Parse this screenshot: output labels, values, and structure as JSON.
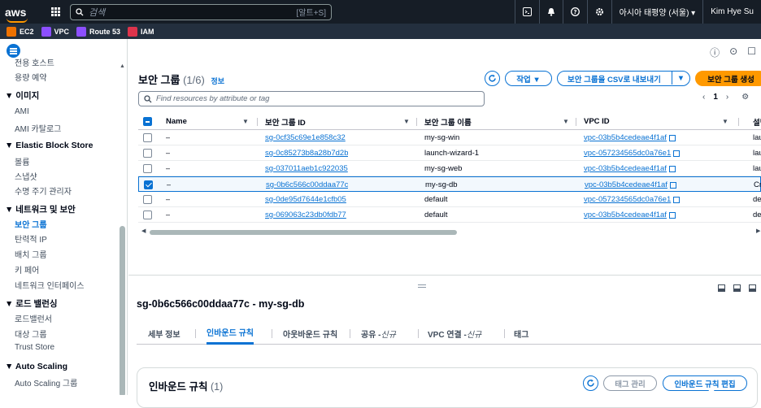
{
  "topbar": {
    "logo": "aws",
    "search_placeholder": "검색",
    "search_shortcut": "[알트+S]",
    "region": "아시아 태평양 (서울) ▾",
    "user": "Kim Hye Su"
  },
  "favorites": [
    {
      "label": "EC2",
      "color": "#ed7100"
    },
    {
      "label": "VPC",
      "color": "#8c4fff"
    },
    {
      "label": "Route 53",
      "color": "#8c4fff"
    },
    {
      "label": "IAM",
      "color": "#dd344c"
    }
  ],
  "sidebar": {
    "items": [
      {
        "label": "전용 호스트",
        "type": "item"
      },
      {
        "label": "용량 예약",
        "type": "item"
      },
      {
        "label": "▼ 이미지",
        "type": "header"
      },
      {
        "label": "AMI",
        "type": "item"
      },
      {
        "label": "AMI 카탈로그",
        "type": "item"
      },
      {
        "label": "▼ Elastic Block Store",
        "type": "header"
      },
      {
        "label": "볼륨",
        "type": "item"
      },
      {
        "label": "스냅샷",
        "type": "item"
      },
      {
        "label": "수명 주기 관리자",
        "type": "item"
      },
      {
        "label": "▼ 네트워크 및 보안",
        "type": "header"
      },
      {
        "label": "보안 그룹",
        "type": "active"
      },
      {
        "label": "탄력적 IP",
        "type": "item"
      },
      {
        "label": "배치 그룹",
        "type": "item"
      },
      {
        "label": "키 페어",
        "type": "item"
      },
      {
        "label": "네트워크 인터페이스",
        "type": "item"
      },
      {
        "label": "▼ 로드 밸런싱",
        "type": "header"
      },
      {
        "label": "로드밸런서",
        "type": "item"
      },
      {
        "label": "대상 그룹",
        "type": "item"
      },
      {
        "label": "Trust Store",
        "type": "item"
      },
      {
        "label": "▼ Auto Scaling",
        "type": "header"
      },
      {
        "label": "Auto Scaling 그룹",
        "type": "item"
      }
    ]
  },
  "panel": {
    "title": "보안 그룹",
    "count": "(1/6)",
    "info": "정보",
    "actions_label": "작업 ▼",
    "export_label": "보안 그룹을 CSV로 내보내기",
    "create_label": "보안 그룹 생성",
    "filter_placeholder": "Find resources by attribute or tag",
    "page": "1"
  },
  "table": {
    "headers": [
      "Name",
      "보안 그룹 ID",
      "보안 그룹 이름",
      "VPC ID",
      "설명"
    ],
    "rows": [
      {
        "name": "–",
        "id": "sg-0cf35c69e1e858c32",
        "group": "my-sg-win",
        "vpc": "vpc-03b5b4cedeae4f1af",
        "desc": "launch",
        "selected": false
      },
      {
        "name": "–",
        "id": "sg-0c85273b8a28b7d2b",
        "group": "launch-wizard-1",
        "vpc": "vpc-057234565dc0a76e1",
        "desc": "launch",
        "selected": false
      },
      {
        "name": "–",
        "id": "sg-037011aeb1c922035",
        "group": "my-sg-web",
        "vpc": "vpc-03b5b4cedeae4f1af",
        "desc": "launch",
        "selected": false
      },
      {
        "name": "–",
        "id": "sg-0b6c566c00ddaa77c",
        "group": "my-sg-db",
        "vpc": "vpc-03b5b4cedeae4f1af",
        "desc": "Create",
        "selected": true
      },
      {
        "name": "–",
        "id": "sg-0de95d7644e1cfb05",
        "group": "default",
        "vpc": "vpc-057234565dc0a76e1",
        "desc": "default",
        "selected": false
      },
      {
        "name": "–",
        "id": "sg-069063c23db0fdb77",
        "group": "default",
        "vpc": "vpc-03b5b4cedeae4f1af",
        "desc": "default",
        "selected": false
      }
    ]
  },
  "detail": {
    "title": "sg-0b6c566c00ddaa77c - my-sg-db",
    "tabs": [
      {
        "label": "세부 정보",
        "active": false
      },
      {
        "label": "인바운드 규칙",
        "active": true
      },
      {
        "label": "아웃바운드 규칙",
        "active": false
      },
      {
        "label": "공유 - ",
        "suffix": "신규",
        "active": false
      },
      {
        "label": "VPC 연결 - ",
        "suffix": "신규",
        "active": false
      },
      {
        "label": "태그",
        "active": false
      }
    ],
    "card_title": "인바운드 규칙",
    "card_count": "(1)",
    "manage_tags_label": "태그 관리",
    "edit_rules_label": "인바운드 규칙 편집"
  }
}
